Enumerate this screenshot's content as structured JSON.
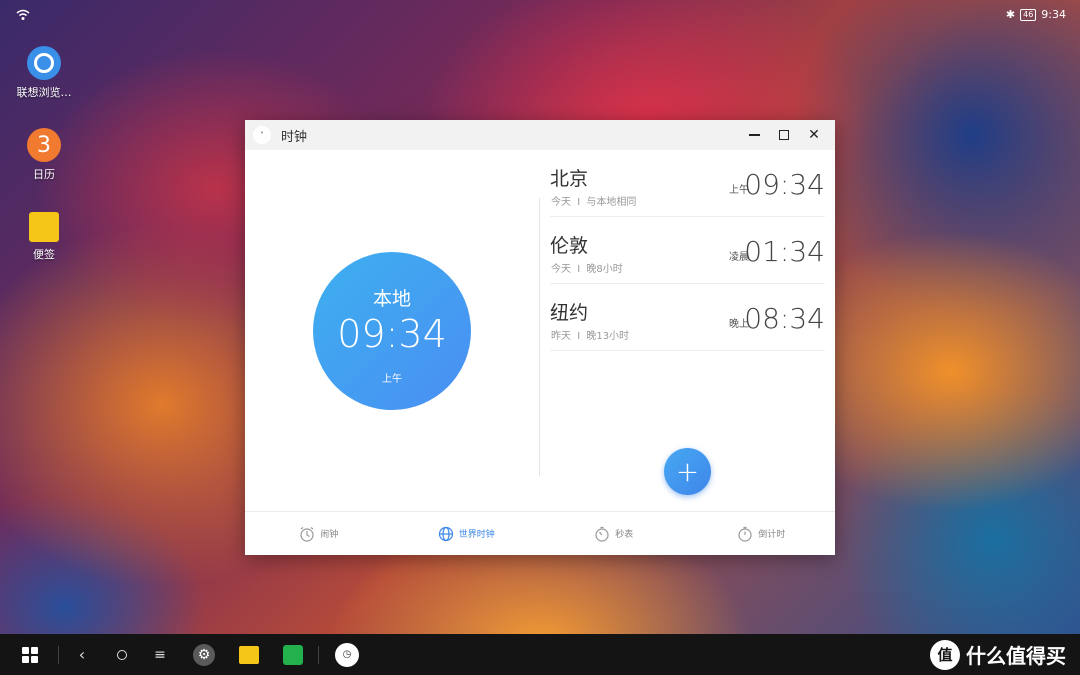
{
  "status_bar": {
    "time": "9:34",
    "battery": "46",
    "bluetooth_glyph": "✱"
  },
  "desktop": {
    "icons": [
      {
        "label": "联想浏览…",
        "icon": "browser-icon"
      },
      {
        "label": "日历",
        "glyph": "3",
        "icon": "calendar-icon"
      },
      {
        "label": "便签",
        "icon": "notes-icon"
      }
    ]
  },
  "window": {
    "title": "时钟",
    "menu_glyph": "˅",
    "close_glyph": "✕",
    "local": {
      "label": "本地",
      "time": "09:34",
      "ampm": "上午"
    },
    "cities": [
      {
        "name": "北京",
        "day": "今天",
        "sep": "I",
        "offset": "与本地相同",
        "ampm": "上午",
        "time": "09:34"
      },
      {
        "name": "伦敦",
        "day": "今天",
        "sep": "I",
        "offset": "晚8小时",
        "ampm": "凌晨",
        "time": "01:34"
      },
      {
        "name": "纽约",
        "day": "昨天",
        "sep": "I",
        "offset": "晚13小时",
        "ampm": "晚上",
        "time": "08:34"
      }
    ],
    "add_glyph": "+",
    "tabs": [
      {
        "label": "闹钟",
        "icon": "alarm-icon",
        "active": false
      },
      {
        "label": "世界时钟",
        "icon": "globe-icon",
        "active": true
      },
      {
        "label": "秒表",
        "icon": "stopwatch-icon",
        "active": false
      },
      {
        "label": "倒计时",
        "icon": "timer-icon",
        "active": false
      }
    ]
  },
  "taskbar": {
    "back_glyph": "‹",
    "recent_glyph": "≡",
    "settings_glyph": "⚙",
    "clock_glyph": "◷",
    "watermark_logo": "值",
    "watermark_text": "什么值得买"
  },
  "colors": {
    "accent": "#3a86e8",
    "circle_start": "#3db0f0",
    "circle_end": "#4a8ef2"
  }
}
